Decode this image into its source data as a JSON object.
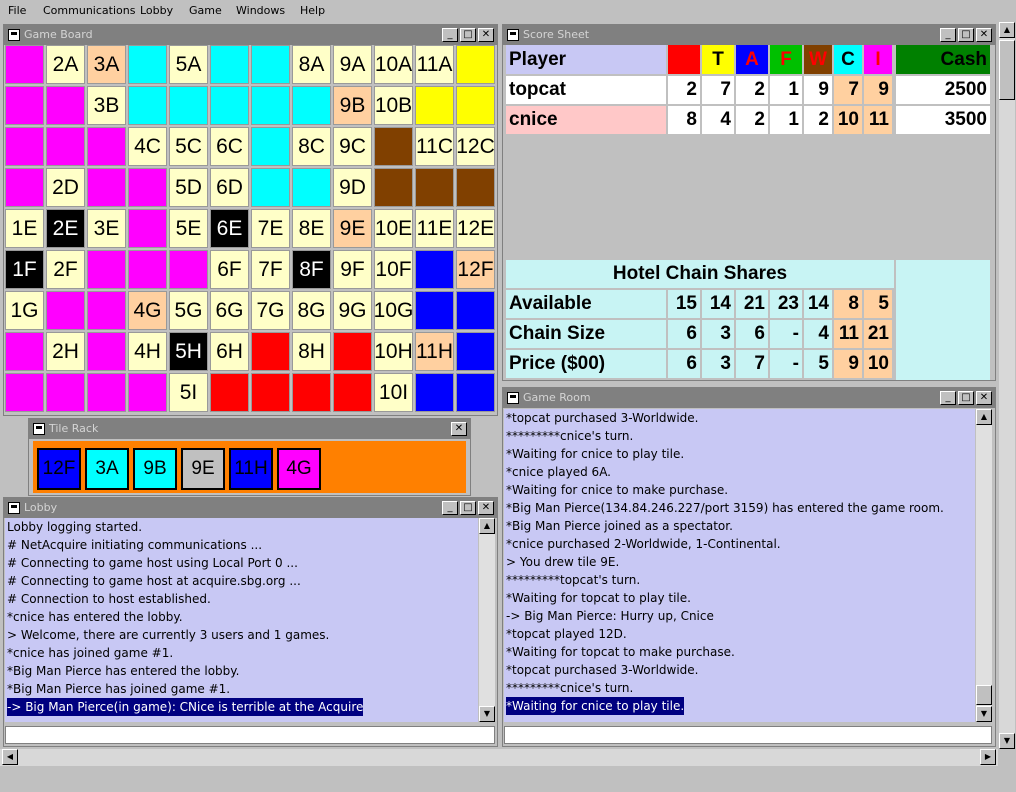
{
  "menu": [
    "File",
    "Communications",
    "Lobby",
    "Game",
    "Windows",
    "Help"
  ],
  "colors": {
    "L": "#ff0000",
    "T": "#ffff00",
    "A": "#0000ff",
    "F": "#00c000",
    "W": "#804000",
    "C": "#00ffff",
    "I": "#ff00ff",
    "empty": "#ffffc8",
    "orange": "#ffd0a0",
    "black": "#000000"
  },
  "game_board": {
    "title": "Game Board",
    "rows": [
      [
        [
          "",
          "I"
        ],
        [
          "2A",
          "empty"
        ],
        [
          "3A",
          "orange"
        ],
        [
          "",
          "C"
        ],
        [
          "5A",
          "empty"
        ],
        [
          "",
          "C"
        ],
        [
          "",
          "C"
        ],
        [
          "8A",
          "empty"
        ],
        [
          "9A",
          "empty"
        ],
        [
          "10A",
          "empty"
        ],
        [
          "11A",
          "empty"
        ],
        [
          "",
          "T"
        ]
      ],
      [
        [
          "",
          "I"
        ],
        [
          "",
          "I"
        ],
        [
          "3B",
          "empty"
        ],
        [
          "",
          "C"
        ],
        [
          "",
          "C"
        ],
        [
          "",
          "C"
        ],
        [
          "",
          "C"
        ],
        [
          "",
          "C"
        ],
        [
          "9B",
          "orange"
        ],
        [
          "10B",
          "empty"
        ],
        [
          "",
          "T"
        ],
        [
          "",
          "T"
        ]
      ],
      [
        [
          "",
          "I"
        ],
        [
          "",
          "I"
        ],
        [
          "",
          "I"
        ],
        [
          "4C",
          "empty"
        ],
        [
          "5C",
          "empty"
        ],
        [
          "6C",
          "empty"
        ],
        [
          "",
          "C"
        ],
        [
          "8C",
          "empty"
        ],
        [
          "9C",
          "empty"
        ],
        [
          "",
          "W"
        ],
        [
          "11C",
          "empty"
        ],
        [
          "12C",
          "empty"
        ]
      ],
      [
        [
          "",
          "I"
        ],
        [
          "2D",
          "empty"
        ],
        [
          "",
          "I"
        ],
        [
          "",
          "I"
        ],
        [
          "5D",
          "empty"
        ],
        [
          "6D",
          "empty"
        ],
        [
          "",
          "C"
        ],
        [
          "",
          "C"
        ],
        [
          "9D",
          "empty"
        ],
        [
          "",
          "W"
        ],
        [
          "",
          "W"
        ],
        [
          "",
          "W"
        ]
      ],
      [
        [
          "1E",
          "empty"
        ],
        [
          "2E",
          "black"
        ],
        [
          "3E",
          "empty"
        ],
        [
          "",
          "I"
        ],
        [
          "5E",
          "empty"
        ],
        [
          "6E",
          "black"
        ],
        [
          "7E",
          "empty"
        ],
        [
          "8E",
          "empty"
        ],
        [
          "9E",
          "orange"
        ],
        [
          "10E",
          "empty"
        ],
        [
          "11E",
          "empty"
        ],
        [
          "12E",
          "empty"
        ]
      ],
      [
        [
          "1F",
          "black"
        ],
        [
          "2F",
          "empty"
        ],
        [
          "",
          "I"
        ],
        [
          "",
          "I"
        ],
        [
          "",
          "I"
        ],
        [
          "6F",
          "empty"
        ],
        [
          "7F",
          "empty"
        ],
        [
          "8F",
          "black"
        ],
        [
          "9F",
          "empty"
        ],
        [
          "10F",
          "empty"
        ],
        [
          "",
          "A"
        ],
        [
          "12F",
          "orange"
        ]
      ],
      [
        [
          "1G",
          "empty"
        ],
        [
          "",
          "I"
        ],
        [
          "",
          "I"
        ],
        [
          "4G",
          "orange"
        ],
        [
          "5G",
          "empty"
        ],
        [
          "6G",
          "empty"
        ],
        [
          "7G",
          "empty"
        ],
        [
          "8G",
          "empty"
        ],
        [
          "9G",
          "empty"
        ],
        [
          "10G",
          "empty"
        ],
        [
          "",
          "A"
        ],
        [
          "",
          "A"
        ]
      ],
      [
        [
          "",
          "I"
        ],
        [
          "2H",
          "empty"
        ],
        [
          "",
          "I"
        ],
        [
          "4H",
          "empty"
        ],
        [
          "5H",
          "black"
        ],
        [
          "6H",
          "empty"
        ],
        [
          "",
          "L"
        ],
        [
          "8H",
          "empty"
        ],
        [
          "",
          "L"
        ],
        [
          "10H",
          "empty"
        ],
        [
          "11H",
          "orange"
        ],
        [
          "",
          "A"
        ]
      ],
      [
        [
          "",
          "I"
        ],
        [
          "",
          "I"
        ],
        [
          "",
          "I"
        ],
        [
          "",
          "I"
        ],
        [
          "5I",
          "empty"
        ],
        [
          "",
          "L"
        ],
        [
          "",
          "L"
        ],
        [
          "",
          "L"
        ],
        [
          "",
          "L"
        ],
        [
          "10I",
          "empty"
        ],
        [
          "",
          "A"
        ],
        [
          "",
          "A"
        ]
      ]
    ]
  },
  "score_sheet": {
    "title": "Score Sheet",
    "header": {
      "player": "Player",
      "chains": [
        "L",
        "T",
        "A",
        "F",
        "W",
        "C",
        "I"
      ],
      "cash": "Cash"
    },
    "players": [
      {
        "name": "topcat",
        "shares": [
          "2",
          "7",
          "2",
          "1",
          "9",
          "7",
          "9"
        ],
        "cash": "2500"
      },
      {
        "name": "cnice",
        "shares": [
          "8",
          "4",
          "2",
          "1",
          "2",
          "10",
          "11"
        ],
        "cash": "3500"
      }
    ],
    "shares_title": "Hotel Chain Shares",
    "rows": [
      {
        "label": "Available",
        "values": [
          "15",
          "14",
          "21",
          "23",
          "14",
          "8",
          "5"
        ]
      },
      {
        "label": "Chain Size",
        "values": [
          "6",
          "3",
          "6",
          "-",
          "4",
          "11",
          "21"
        ]
      },
      {
        "label": "Price ($00)",
        "values": [
          "6",
          "3",
          "7",
          "-",
          "5",
          "9",
          "10"
        ]
      }
    ]
  },
  "tile_rack": {
    "title": "Tile Rack",
    "tiles": [
      [
        "12F",
        "#0000ff"
      ],
      [
        "3A",
        "#00ffff"
      ],
      [
        "9B",
        "#00ffff"
      ],
      [
        "9E",
        "#c0c0c0"
      ],
      [
        "11H",
        "#0000ff"
      ],
      [
        "4G",
        "#ff00ff"
      ]
    ]
  },
  "lobby": {
    "title": "Lobby",
    "lines": [
      "Lobby logging started.",
      "# NetAcquire initiating communications ...",
      "# Connecting to game host using Local Port 0 ...",
      "# Connecting to game host at acquire.sbg.org ...",
      "# Connection to host established.",
      "*cnice has entered the lobby.",
      "> Welcome, there are currently 3 users and 1 games.",
      "*cnice has joined game #1.",
      "*Big Man Pierce has entered the lobby.",
      "*Big Man Pierce has joined game #1."
    ],
    "highlighted": "-> Big Man Pierce(in game): CNice is terrible at the Acquire",
    "input_value": ""
  },
  "game_room": {
    "title": "Game Room",
    "lines": [
      "*topcat purchased 3-Worldwide.",
      "*********cnice's turn.",
      "*Waiting for cnice to play tile.",
      "*cnice played 6A.",
      "*Waiting for cnice to make purchase.",
      "*Big Man Pierce(134.84.246.227/port 3159) has entered the game room.",
      "*Big Man Pierce joined as a spectator.",
      "*cnice purchased 2-Worldwide, 1-Continental.",
      "> You drew tile 9E.",
      "*********topcat's turn.",
      "*Waiting for topcat to play tile.",
      "-> Big Man Pierce: Hurry up, Cnice",
      "*topcat played 12D.",
      "*Waiting for topcat to make purchase.",
      "*topcat purchased 3-Worldwide.",
      "*********cnice's turn."
    ],
    "highlighted": "*Waiting for cnice to play tile.",
    "input_value": ""
  }
}
